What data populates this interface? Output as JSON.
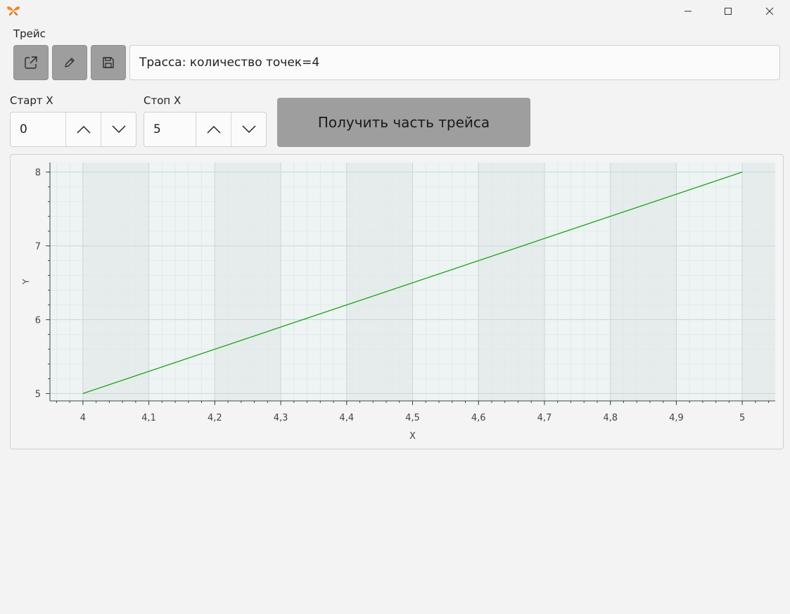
{
  "window": {
    "minimize_icon": "minimize-icon",
    "maximize_icon": "maximize-icon",
    "close_icon": "close-icon",
    "app_icon": "butterfly-icon",
    "app_icon_color": "#f08a24"
  },
  "trace": {
    "label": "Трейс",
    "info": "Трасса: количество точек=4",
    "toolbar": {
      "open_icon": "open-external-icon",
      "edit_icon": "pencil-icon",
      "save_icon": "save-icon"
    }
  },
  "range": {
    "start": {
      "label": "Старт X",
      "value": "0"
    },
    "stop": {
      "label": "Стоп X",
      "value": "5"
    }
  },
  "get_part_button": {
    "label": "Получить часть трейса"
  },
  "colors": {
    "button_bg": "#9e9e9e",
    "line": "#1aa31a",
    "grid_major": "#c9d8d8",
    "grid_minor": "#dde9e9",
    "band_dark": "#e6ecec",
    "band_light": "#eef3f3"
  },
  "chart_data": {
    "type": "line",
    "xlabel": "X",
    "ylabel": "Y",
    "xlim": [
      3.95,
      5.05
    ],
    "ylim": [
      4.9,
      8.13
    ],
    "x_ticks": [
      4,
      4.1,
      4.2,
      4.3,
      4.4,
      4.5,
      4.6,
      4.7,
      4.8,
      4.9,
      5
    ],
    "x_tick_labels": [
      "4",
      "4,1",
      "4,2",
      "4,3",
      "4,4",
      "4,5",
      "4,6",
      "4,7",
      "4,8",
      "4,9",
      "5"
    ],
    "y_ticks": [
      5,
      6,
      7,
      8
    ],
    "y_tick_labels": [
      "5",
      "6",
      "7",
      "8"
    ],
    "grid": true,
    "series": [
      {
        "x": [
          4,
          5
        ],
        "y": [
          5,
          8
        ]
      }
    ]
  }
}
